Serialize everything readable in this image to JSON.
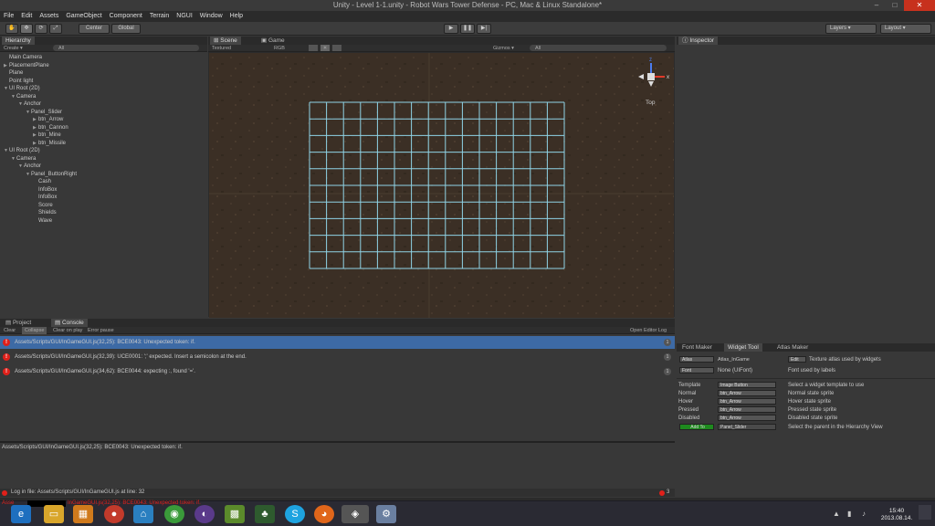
{
  "window": {
    "title": "Unity - Level 1-1.unity - Robot Wars Tower Defense - PC, Mac & Linux Standalone*",
    "controls": [
      "–",
      "□",
      "✕"
    ]
  },
  "menu": [
    "File",
    "Edit",
    "Assets",
    "GameObject",
    "Component",
    "Terrain",
    "NGUI",
    "Window",
    "Help"
  ],
  "toolbar": {
    "pivot": "Center",
    "space": "Global",
    "layers": "Layers",
    "layout": "Layout"
  },
  "hierarchy": {
    "tab": "Hierarchy",
    "create": "Create ▾",
    "search_placeholder": "All",
    "items": [
      {
        "label": "Main Camera",
        "indent": 0,
        "arrow": ""
      },
      {
        "label": "PlacementPlane",
        "indent": 0,
        "arrow": "▶"
      },
      {
        "label": "Plane",
        "indent": 0,
        "arrow": ""
      },
      {
        "label": "Point light",
        "indent": 0,
        "arrow": ""
      },
      {
        "label": "UI Root (2D)",
        "indent": 0,
        "arrow": "▼"
      },
      {
        "label": "Camera",
        "indent": 1,
        "arrow": "▼"
      },
      {
        "label": "Anchor",
        "indent": 2,
        "arrow": "▼"
      },
      {
        "label": "Panel_Slider",
        "indent": 3,
        "arrow": "▼"
      },
      {
        "label": "btn_Arrow",
        "indent": 4,
        "arrow": "▶"
      },
      {
        "label": "btn_Cannon",
        "indent": 4,
        "arrow": "▶"
      },
      {
        "label": "btn_Mine",
        "indent": 4,
        "arrow": "▶"
      },
      {
        "label": "btn_Missile",
        "indent": 4,
        "arrow": "▶"
      },
      {
        "label": "UI Root (2D)",
        "indent": 0,
        "arrow": "▼"
      },
      {
        "label": "Camera",
        "indent": 1,
        "arrow": "▼"
      },
      {
        "label": "Anchor",
        "indent": 2,
        "arrow": "▼"
      },
      {
        "label": "Panel_ButtonRight",
        "indent": 3,
        "arrow": "▼"
      },
      {
        "label": "Cash",
        "indent": 4,
        "arrow": ""
      },
      {
        "label": "InfoBox",
        "indent": 4,
        "arrow": ""
      },
      {
        "label": "InfoBox",
        "indent": 4,
        "arrow": ""
      },
      {
        "label": "Score",
        "indent": 4,
        "arrow": ""
      },
      {
        "label": "Shields",
        "indent": 4,
        "arrow": ""
      },
      {
        "label": "Wave",
        "indent": 4,
        "arrow": ""
      }
    ]
  },
  "scene": {
    "tabs": [
      "Scene",
      "Game"
    ],
    "render_mode": "Textured",
    "color_mode": "RGB",
    "gizmos": "Gizmos ▾",
    "search_placeholder": "All",
    "orientation": "Top",
    "gizmo_axes": [
      "z",
      "x"
    ]
  },
  "console": {
    "tabs": [
      "Project",
      "Console"
    ],
    "buttons": [
      "Clear",
      "Collapse",
      "Clear on play",
      "Error pause"
    ],
    "open_editor_log": "Open Editor Log",
    "entries": [
      {
        "text": "Assets/Scripts/GUI/InGameGUI.js(32,25): BCE0043: Unexpected token: if.",
        "count": "1",
        "selected": true
      },
      {
        "text": "Assets/Scripts/GUI/InGameGUI.js(32,39): UCE0001: ';' expected. Insert a semicolon at the end.",
        "count": "1",
        "selected": false
      },
      {
        "text": "Assets/Scripts/GUI/InGameGUI.js(34,62): BCE0044: expecting :, found '='.",
        "count": "1",
        "selected": false
      }
    ],
    "detail": "Assets/Scripts/GUI/InGameGUI.js(32,25): BCE0043: Unexpected token: if.",
    "log_location": "Log in file: Assets/Scripts/GUI/InGameGUI.js at line: 32",
    "error_count": "3",
    "status_prefix": "Asse",
    "status_text": "InGameGUI.js(32,25): BCE0043: Unexpected token: if."
  },
  "inspector": {
    "tab": "Inspector"
  },
  "widget_tool": {
    "tabs": [
      "Font Maker",
      "Widget Tool",
      "Atlas Maker"
    ],
    "atlas_label": "Atlas",
    "atlas_value": "Atlas_InGame",
    "edit": "Edit",
    "atlas_hint": "Texture atlas used by widgets",
    "font_label": "Font",
    "font_value": "None (UIFont)",
    "font_hint": "Font used by labels",
    "rows": [
      {
        "label": "Template",
        "value": "Image Button",
        "hint": "Select a widget template to use"
      },
      {
        "label": "Normal",
        "value": "btn_Arrow",
        "hint": "Normal state sprite"
      },
      {
        "label": "Hover",
        "value": "btn_Arrow",
        "hint": "Hover state sprite"
      },
      {
        "label": "Pressed",
        "value": "btn_Arrow",
        "hint": "Pressed state sprite"
      },
      {
        "label": "Disabled",
        "value": "btn_Arrow",
        "hint": "Disabled state sprite"
      }
    ],
    "add_to": "Add To",
    "parent_value": "Panel_Slider",
    "parent_hint": "Select the parent in the Hierarchy View"
  },
  "taskbar": {
    "time": "15:40",
    "date": "2013.08.14.",
    "icons": [
      "ie-icon",
      "explorer-icon",
      "photoshop-icon",
      "chrome-canary-icon",
      "network-icon",
      "chrome-icon",
      "eclipse-icon",
      "minecraft-icon",
      "tree-icon",
      "skype-icon",
      "firefox-icon",
      "unity-icon",
      "cmd-icon"
    ]
  },
  "colors": {
    "selection": "#3d6aa5",
    "error": "#e0201a",
    "grid": "#8fd3e6",
    "scene_bg": "#3b2f25",
    "add_to_button": "#1e8a1e"
  }
}
